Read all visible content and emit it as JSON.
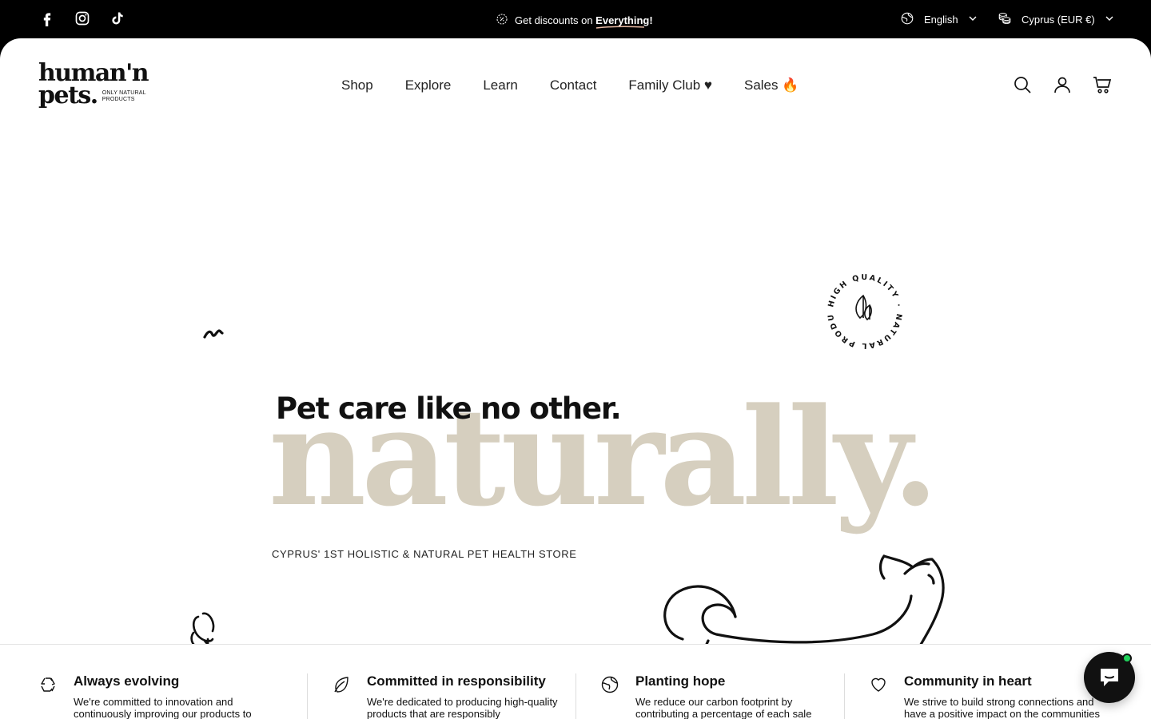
{
  "topbar": {
    "social": [
      {
        "icon": "facebook-icon"
      },
      {
        "icon": "instagram-icon"
      },
      {
        "icon": "tiktok-icon"
      }
    ],
    "promo_prefix": "Get discounts on ",
    "promo_emphasis": "Everything",
    "promo_suffix": "!",
    "language": "English",
    "currency": "Cyprus (EUR €)"
  },
  "header": {
    "logo_line1": "human'n",
    "logo_line2": "pets.",
    "logo_tag_line1": "ONLY NATURAL",
    "logo_tag_line2": "PRODUCTS",
    "nav": [
      "Shop",
      "Explore",
      "Learn",
      "Contact",
      "Family Club ♥",
      "Sales 🔥"
    ]
  },
  "hero": {
    "tagline": "Pet care like no other.",
    "headline": "naturally.",
    "subline": "CYPRUS' 1ST HOLISTIC & NATURAL PET HEALTH STORE",
    "seal_text": "HIGH QUALITY · NATURAL PRODUCTS ·"
  },
  "features": [
    {
      "icon": "recycle-icon",
      "title": "Always evolving",
      "desc": "We're committed to innovation and continuously improving our products to"
    },
    {
      "icon": "leaf-icon",
      "title": "Committed in responsibility",
      "desc": "We're dedicated to producing high-quality products that are responsibly"
    },
    {
      "icon": "globe-icon",
      "title": "Planting hope",
      "desc": "We reduce our carbon footprint by contributing a percentage of each sale"
    },
    {
      "icon": "heart-icon",
      "title": "Community in heart",
      "desc": "We strive to build strong connections and have a positive impact on the communities"
    }
  ],
  "colors": {
    "topbar_bg": "#000000",
    "headline": "#d6cfbf",
    "chat_bg": "#111111",
    "chat_status": "#1fd15a"
  }
}
